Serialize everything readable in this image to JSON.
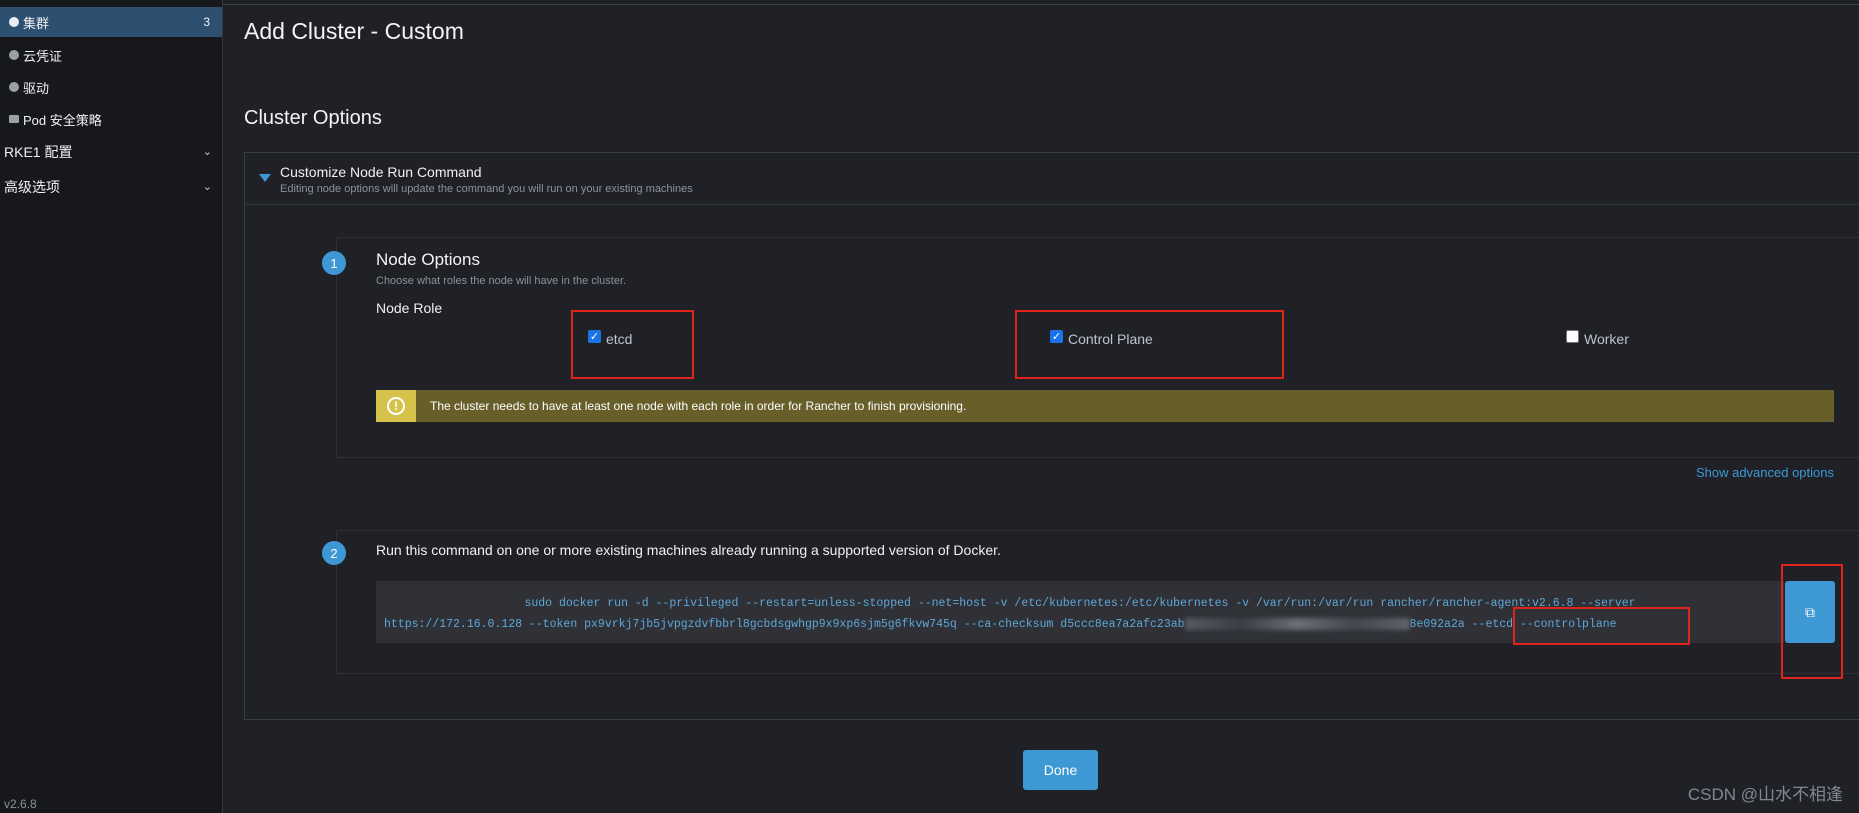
{
  "sidebar": {
    "items": [
      {
        "label": "集群",
        "count": "3"
      },
      {
        "label": "云凭证"
      },
      {
        "label": "驱动"
      },
      {
        "label": "Pod 安全策略"
      }
    ],
    "groups": [
      {
        "label": "RKE1 配置"
      },
      {
        "label": "高级选项"
      }
    ],
    "version": "v2.6.8"
  },
  "page": {
    "title": "Add Cluster - Custom",
    "section_title": "Cluster Options"
  },
  "customize": {
    "title": "Customize Node Run Command",
    "subtitle": "Editing node options will update the command you will run on your existing machines"
  },
  "node_options": {
    "step": "1",
    "title": "Node Options",
    "subtitle": "Choose what roles the node will have in the cluster.",
    "role_label": "Node Role",
    "roles": [
      {
        "label": "etcd",
        "checked": true
      },
      {
        "label": "Control Plane",
        "checked": true
      },
      {
        "label": "Worker",
        "checked": false
      }
    ],
    "warning": "The cluster needs to have at least one node with each role in order for Rancher to finish provisioning.",
    "advanced_link": "Show advanced options"
  },
  "run_command": {
    "step": "2",
    "title": "Run this command on one or more existing machines already running a supported version of Docker.",
    "line1": "sudo docker run -d --privileged --restart=unless-stopped --net=host -v /etc/kubernetes:/etc/kubernetes -v /var/run:/var/run  rancher/rancher-agent:v2.6.8 --server",
    "line2_start": "https://172.16.0.128 --token px9vrkj7jb5jvpgzdvfbbrl8gcbdsgwhgp9x9xp6sjm5g6fkvw745q --ca-checksum d5ccc8ea7a2afc23ab",
    "line2_end": "8e092a2a --etcd --controlplane"
  },
  "done_label": "Done",
  "watermark": "CSDN @山水不相逢",
  "colors": {
    "accent": "#3d98d3",
    "highlight": "#e0231b",
    "warning_bg": "#675e2a"
  }
}
